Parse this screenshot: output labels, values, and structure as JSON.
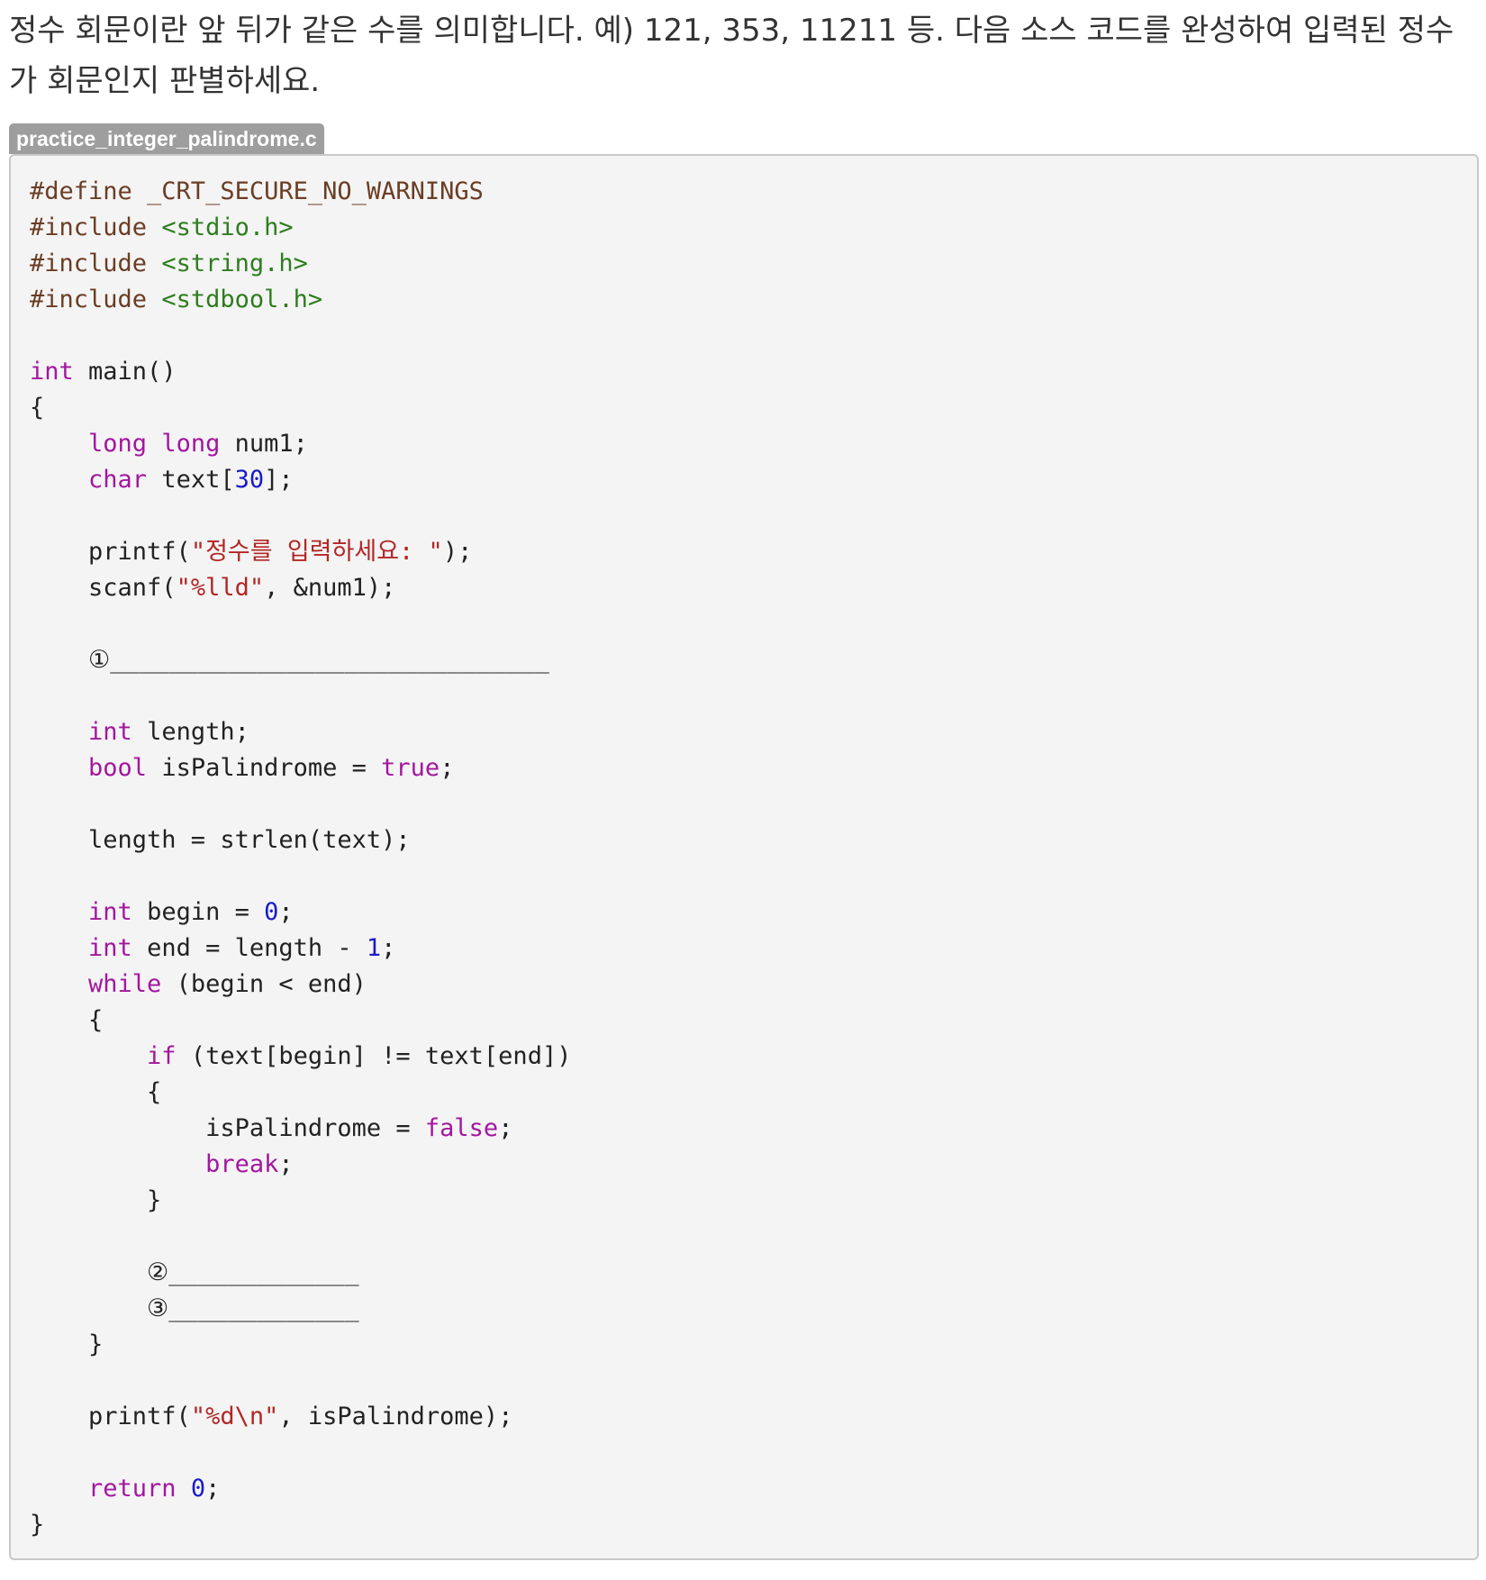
{
  "question": {
    "text": "정수 회문이란 앞 뒤가 같은 수를 의미합니다. 예) 121, 353, 11211 등. 다음 소스 코드를 완성하여 입력된 정수가 회문인지 판별하세요."
  },
  "code_block": {
    "filename": "practice_integer_palindrome.c",
    "lines": [
      [
        {
          "t": "#define _CRT_SECURE_NO_WARNINGS",
          "c": "pp"
        }
      ],
      [
        {
          "t": "#include ",
          "c": "pp"
        },
        {
          "t": "<stdio.h>",
          "c": "inc"
        }
      ],
      [
        {
          "t": "#include ",
          "c": "pp"
        },
        {
          "t": "<string.h>",
          "c": "inc"
        }
      ],
      [
        {
          "t": "#include ",
          "c": "pp"
        },
        {
          "t": "<stdbool.h>",
          "c": "inc"
        }
      ],
      [],
      [
        {
          "t": "int",
          "c": "kw"
        },
        {
          "t": " main()"
        }
      ],
      [
        {
          "t": "{"
        }
      ],
      [
        {
          "t": "    "
        },
        {
          "t": "long",
          "c": "kw"
        },
        {
          "t": " "
        },
        {
          "t": "long",
          "c": "kw"
        },
        {
          "t": " num1;"
        }
      ],
      [
        {
          "t": "    "
        },
        {
          "t": "char",
          "c": "kw"
        },
        {
          "t": " text["
        },
        {
          "t": "30",
          "c": "num"
        },
        {
          "t": "];"
        }
      ],
      [],
      [
        {
          "t": "    printf("
        },
        {
          "t": "\"정수를 입력하세요: \"",
          "c": "str"
        },
        {
          "t": ");"
        }
      ],
      [
        {
          "t": "    scanf("
        },
        {
          "t": "\"%lld\"",
          "c": "str"
        },
        {
          "t": ", &num1);"
        }
      ],
      [],
      [
        {
          "t": "    ①______________________________",
          "c": "blank"
        }
      ],
      [],
      [
        {
          "t": "    "
        },
        {
          "t": "int",
          "c": "kw"
        },
        {
          "t": " length;"
        }
      ],
      [
        {
          "t": "    "
        },
        {
          "t": "bool",
          "c": "kw"
        },
        {
          "t": " isPalindrome = "
        },
        {
          "t": "true",
          "c": "kw"
        },
        {
          "t": ";"
        }
      ],
      [],
      [
        {
          "t": "    length = strlen(text);"
        }
      ],
      [],
      [
        {
          "t": "    "
        },
        {
          "t": "int",
          "c": "kw"
        },
        {
          "t": " begin = "
        },
        {
          "t": "0",
          "c": "num"
        },
        {
          "t": ";"
        }
      ],
      [
        {
          "t": "    "
        },
        {
          "t": "int",
          "c": "kw"
        },
        {
          "t": " end = length - "
        },
        {
          "t": "1",
          "c": "num"
        },
        {
          "t": ";"
        }
      ],
      [
        {
          "t": "    "
        },
        {
          "t": "while",
          "c": "kw"
        },
        {
          "t": " (begin < end)"
        }
      ],
      [
        {
          "t": "    {"
        }
      ],
      [
        {
          "t": "        "
        },
        {
          "t": "if",
          "c": "kw"
        },
        {
          "t": " (text[begin] != text[end])"
        }
      ],
      [
        {
          "t": "        {"
        }
      ],
      [
        {
          "t": "            isPalindrome = "
        },
        {
          "t": "false",
          "c": "kw"
        },
        {
          "t": ";"
        }
      ],
      [
        {
          "t": "            "
        },
        {
          "t": "break",
          "c": "kw"
        },
        {
          "t": ";"
        }
      ],
      [
        {
          "t": "        }"
        }
      ],
      [],
      [
        {
          "t": "        ②_____________",
          "c": "blank"
        }
      ],
      [
        {
          "t": "        ③_____________",
          "c": "blank"
        }
      ],
      [
        {
          "t": "    }"
        }
      ],
      [],
      [
        {
          "t": "    printf("
        },
        {
          "t": "\"%d\\n\"",
          "c": "str"
        },
        {
          "t": ", isPalindrome);"
        }
      ],
      [],
      [
        {
          "t": "    "
        },
        {
          "t": "return",
          "c": "kw"
        },
        {
          "t": " "
        },
        {
          "t": "0",
          "c": "num"
        },
        {
          "t": ";"
        }
      ],
      [
        {
          "t": "}"
        }
      ]
    ]
  }
}
